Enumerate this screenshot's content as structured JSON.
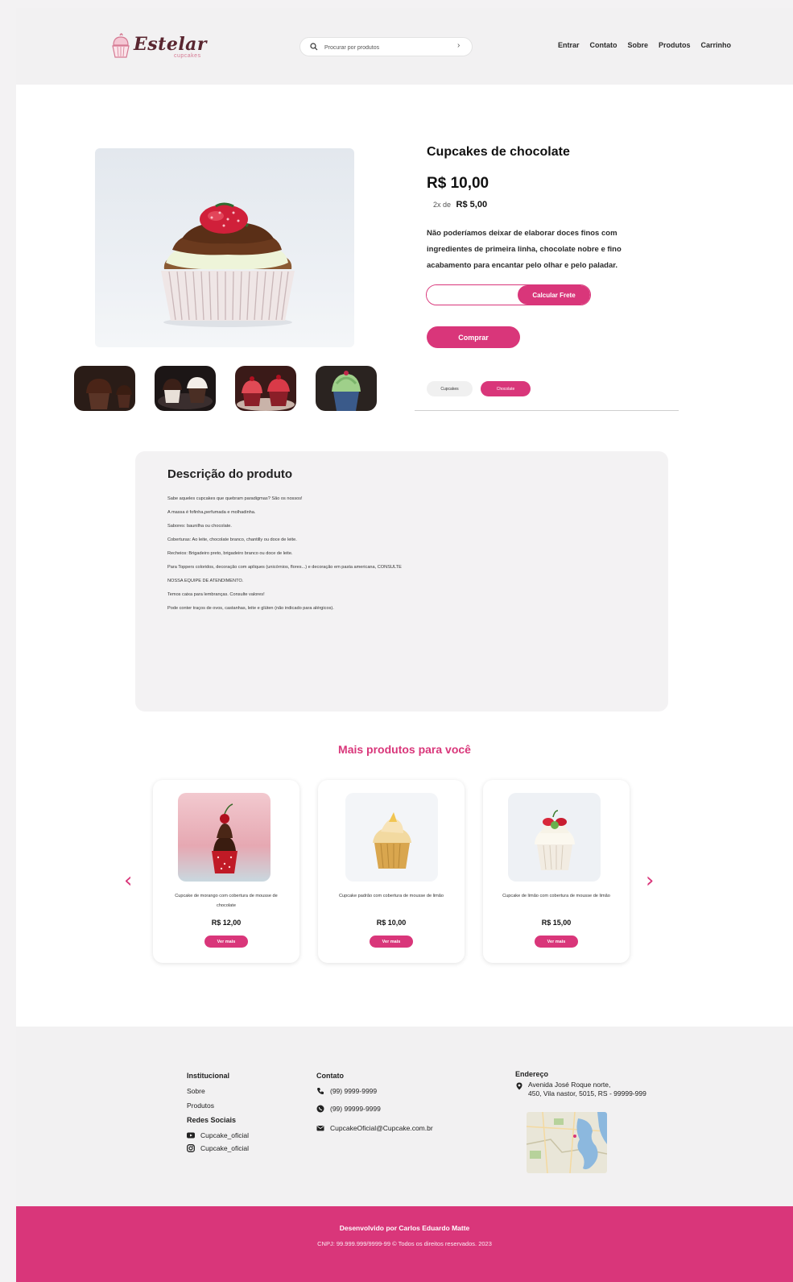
{
  "header": {
    "logo_text": "Estelar",
    "logo_sub": "cupcakes",
    "search_placeholder": "Procurar por produtos",
    "nav": [
      "Entrar",
      "Contato",
      "Sobre",
      "Produtos",
      "Carrinho"
    ]
  },
  "product": {
    "title": "Cupcakes de chocolate",
    "price": "R$ 10,00",
    "installments_prefix": "2x de",
    "installments_value": "R$ 5,00",
    "description": "Não poderíamos deixar de elaborar doces finos com ingredientes de primeira linha, chocolate nobre e fino acabamento para encantar pelo olhar e pelo paladar.",
    "shipping_button": "Calcular Frete",
    "buy_button": "Comprar",
    "tags": [
      "Cupcakes",
      "Chocolate"
    ]
  },
  "details": {
    "title": "Descrição do produto",
    "lines": [
      "Sabe aqueles cupcakes que quebram paradigmas? São os nossos!",
      "A massa é fofinha,perfumada e molhadinha.",
      "Sabores: baunilha ou chocolate.",
      "Coberturas: Ao leite, chocolate branco, chantilly ou doce de leite.",
      "Recheios: Brigadeiro preto, brigadeiro branco ou doce de leite.",
      "Para Toppers coloridos, decoração com apliques (unicórnios, flores...) e decoração em pasta americana, CONSULTE",
      "NOSSA EQUIPE DE ATENDIMENTO.",
      "Temos caixa para lembranças. Consulte valores!",
      "Pode conter traços de ovos, castanhas, leite e glúten (não indicado para alérgicos)."
    ]
  },
  "related": {
    "title": "Mais produtos para você",
    "items": [
      {
        "name": "Cupcake de morango com cobertura de mousse de chocolate",
        "price": "R$ 12,00",
        "button": "Ver mais"
      },
      {
        "name": "Cupcake padrão com cobertura de mousse de limão",
        "price": "R$ 10,00",
        "button": "Ver mais"
      },
      {
        "name": "Cupcake de limão com cobertura de mousse de limão",
        "price": "R$ 15,00",
        "button": "Ver mais"
      }
    ]
  },
  "footer": {
    "institutional_title": "Institucional",
    "institutional_links": [
      "Sobre",
      "Produtos"
    ],
    "social_title": "Redes Sociais",
    "social": [
      "Cupcake_oficial",
      "Cupcake_oficial"
    ],
    "contact_title": "Contato",
    "phone": "(99) 9999-9999",
    "whatsapp": "(99) 99999-9999",
    "email": "CupcakeOficial@Cupcake.com.br",
    "address_title": "Endereço",
    "address_line1": "Avenida José Roque norte,",
    "address_line2": "450, Vila nastor, 5015, RS  - 99999-999",
    "credit": "Desenvolvido por Carlos Eduardo Matte",
    "legal": "CNPJ: 99.999.999/9999-99 © Todos os direitos reservados. 2023"
  },
  "colors": {
    "accent": "#d9367a",
    "background": "#f3f2f3"
  }
}
